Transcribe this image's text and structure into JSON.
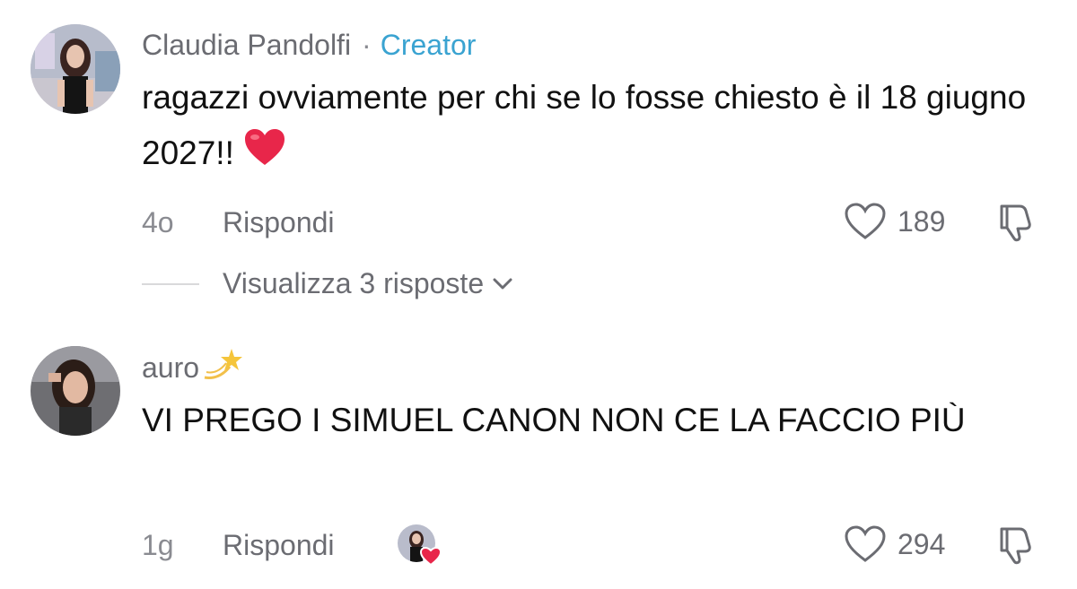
{
  "comments": [
    {
      "author": "Claudia Pandolfi",
      "separator": "·",
      "badge": "Creator",
      "text": "ragazzi ovviamente per chi se lo fosse chiesto è il 18 giugno 2027!!",
      "text_emoji": "red-heart",
      "time": "4o",
      "reply_label": "Rispondi",
      "likes": "189",
      "view_replies": "Visualizza 3 risposte"
    },
    {
      "author": "auro",
      "author_emoji": "dizzy-star",
      "text": "VI PREGO I SIMUEL CANON NON CE LA FACCIO PIÙ",
      "time": "1g",
      "reply_label": "Rispondi",
      "likes": "294",
      "creator_liked": true
    }
  ],
  "colors": {
    "creator_badge": "#3aa3d1",
    "secondary_text": "#6b6c72",
    "heart": "#e8264a"
  }
}
